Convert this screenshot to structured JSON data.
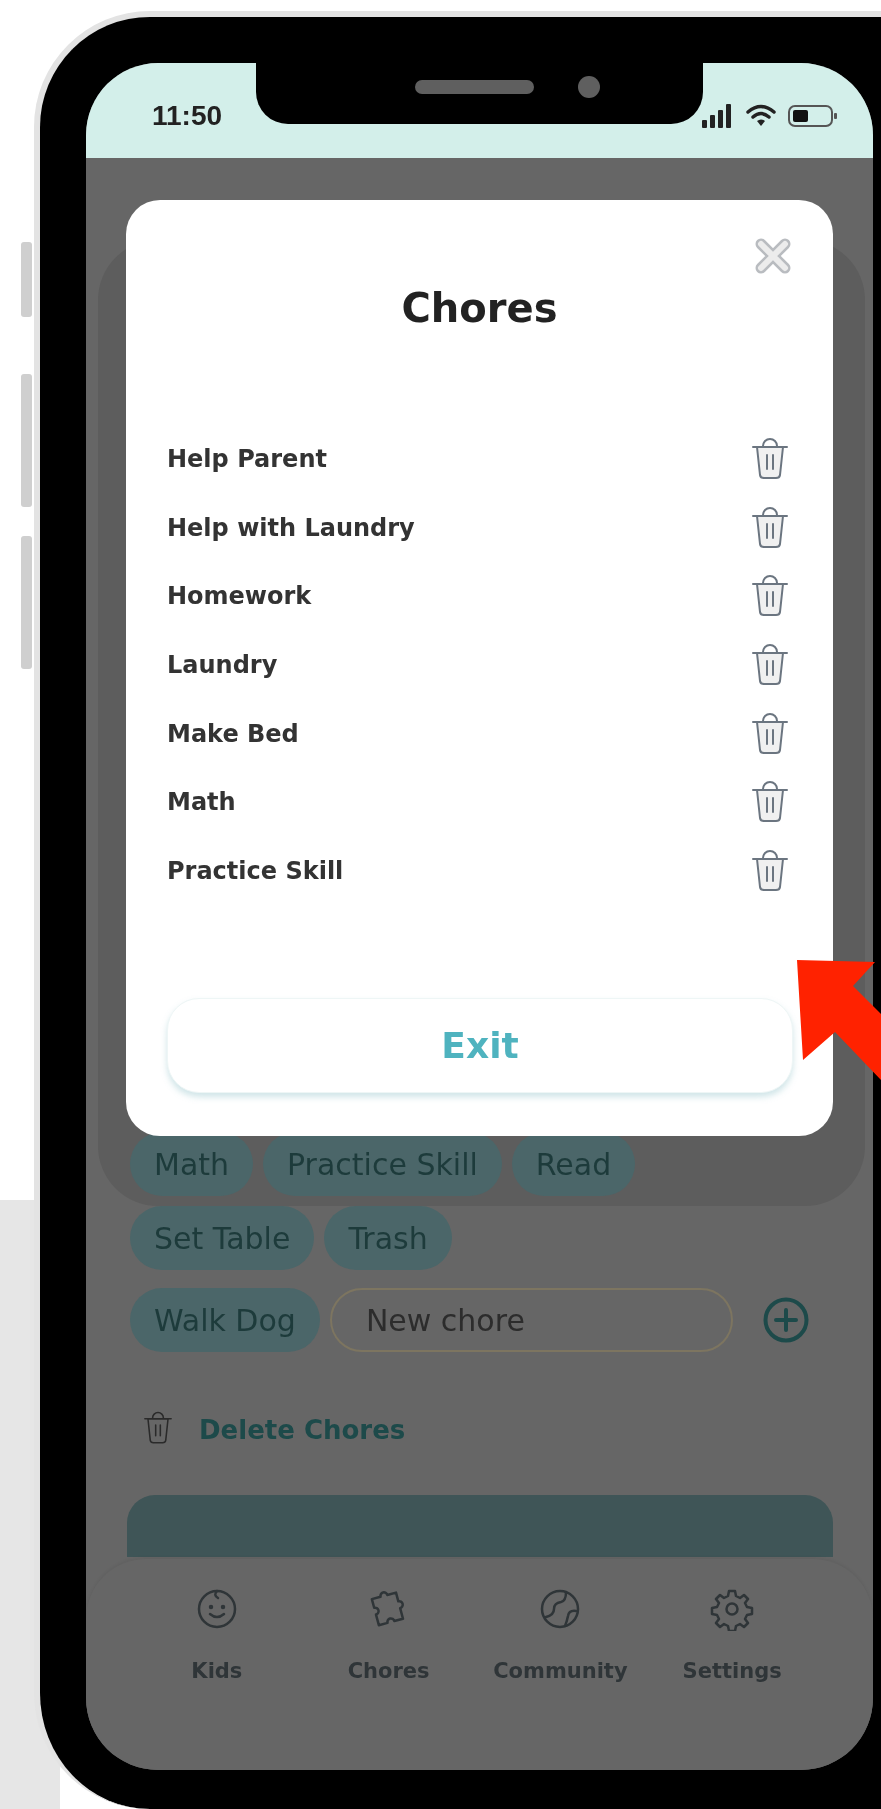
{
  "status_bar": {
    "time": "11:50"
  },
  "page": {
    "chip_rows": [
      [
        "Math",
        "Practice Skill",
        "Read"
      ],
      [
        "Set Table",
        "Trash"
      ],
      [
        "Walk Dog"
      ]
    ],
    "new_chore": {
      "placeholder": "New chore"
    },
    "delete_chores": "Delete Chores"
  },
  "modal": {
    "title": "Chores",
    "chores": [
      "Help Parent",
      "Help with Laundry",
      "Homework",
      "Laundry",
      "Make Bed",
      "Math",
      "Practice Skill"
    ],
    "exit_button": "Exit"
  },
  "tab_bar": {
    "tabs": [
      {
        "label": "Kids",
        "kind": "kids"
      },
      {
        "label": "Chores",
        "kind": "chores"
      },
      {
        "label": "Community",
        "kind": "community"
      },
      {
        "label": "Settings",
        "kind": "settings"
      }
    ]
  }
}
